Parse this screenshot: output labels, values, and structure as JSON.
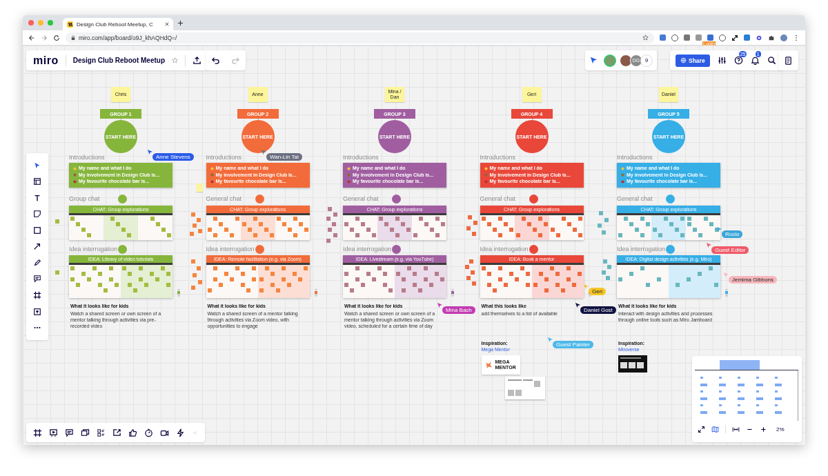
{
  "browser": {
    "tab_title": "Design Club Reboot Meetup, C",
    "url": "miro.com/app/board/o9J_khAQHdQ=/",
    "extension_badge": "Login"
  },
  "board_header": {
    "logo": "miro",
    "title": "Design Club Reboot Meetup",
    "starred": false
  },
  "collaborators": {
    "initials": "DG",
    "count": "9"
  },
  "share_label": "Share",
  "help_badge": "25",
  "notification_badge": "1",
  "groups": [
    {
      "name": "Chris",
      "label": "GROUP 1",
      "color": "#86b53c",
      "start": "START HERE",
      "intro_heading": "Introductions",
      "intro_items": [
        "My name and what I do",
        "My involvement in Design Club is...",
        "My favourite chocolate bar is..."
      ],
      "chat_heading": "Group chat",
      "chat_title": "CHAT: Group explorations",
      "idea_heading": "Idea interrogation",
      "idea_title": "IDEA: Library of video tutorials",
      "looks_heading": "What it looks like for kids",
      "description": "Watch a shared screen or own screen of a mentor talking through activities via pre-recorded video"
    },
    {
      "name": "Anne",
      "label": "GROUP 2",
      "color": "#f26b3a",
      "start": "START HERE",
      "intro_heading": "Introductions",
      "intro_items": [
        "My name and what I do",
        "My involvement in Design Club is...",
        "My favourite chocolate bar is..."
      ],
      "chat_heading": "General chat",
      "chat_title": "CHAT: Group explorations",
      "idea_heading": "Idea interrogation",
      "idea_title": "IDEA: Remote facilitation (e.g. via Zoom)",
      "looks_heading": "What it looks like for kids",
      "description": "Watch a shared screen of a mentor talking through activities via Zoom video, with opportunities to engage"
    },
    {
      "name": "Mina / Dan",
      "label": "GROUP 3",
      "color": "#a05ea0",
      "start": "START HERE",
      "intro_heading": "Introductions",
      "intro_items": [
        "My name and what I do",
        "My involvement in Design Club is...",
        "My favourite chocolate bar is..."
      ],
      "chat_heading": "General chat",
      "chat_title": "CHAT: Group explorations",
      "idea_heading": "Idea interrogation",
      "idea_title": "IDEA: Livestream (e.g. via YouTube)",
      "looks_heading": "What it looks like for kids",
      "description": "Watch a shared screen or own screen of a mentor talking through activities via Zoom video, scheduled for a certain time of day"
    },
    {
      "name": "Geri",
      "label": "GROUP 4",
      "color": "#e8473a",
      "start": "START HERE",
      "intro_heading": "Introductions",
      "intro_items": [
        "My name and what I do",
        "My involvement in Design Club is...",
        "My favourite chocolate bar is..."
      ],
      "chat_heading": "General chat",
      "chat_title": "CHAT: Group explorations",
      "idea_heading": "Idea interrogation",
      "idea_title": "IDEA: Book a mentor",
      "looks_heading": "What this looks like",
      "description": "add themselves to a list of available",
      "inspiration": {
        "label": "Inspiration:",
        "link": "Mega Mentor",
        "thumbnail_text": "MEGA MENTOR"
      }
    },
    {
      "name": "Daniel",
      "label": "GROUP 5",
      "color": "#36aee6",
      "start": "START HERE",
      "intro_heading": "Introductions",
      "intro_items": [
        "My name and what I do",
        "My involvement in Design Club is...",
        "My favourite chocolate bar is..."
      ],
      "chat_heading": "General chat",
      "chat_title": "CHAT: Group explorations",
      "idea_heading": "Idea interrogation",
      "idea_title": "IDEA: Digital design activities (e.g. Miro)",
      "looks_heading": "What it looks like for kids",
      "description": "Interact with design activities and processes through online tools such as Miro Jamboard",
      "inspiration": {
        "label": "Inspiration:",
        "link": "Miroverse"
      }
    }
  ],
  "cursors": [
    {
      "name": "Anne Stevens",
      "color": "#2a5be8"
    },
    {
      "name": "Wan-Lin Tai",
      "color": "#6b6f80"
    },
    {
      "name": "Mina Bach",
      "color": "#c23bb3"
    },
    {
      "name": "Geri",
      "color": "#f5c629"
    },
    {
      "name": "Guest Painter",
      "color": "#4cb8e8"
    },
    {
      "name": "Daniel Gost",
      "color": "#0f1140"
    },
    {
      "name": "Rocio",
      "color": "#3aa5d8"
    },
    {
      "name": "Guest Editor",
      "color": "#ef5a6a"
    },
    {
      "name": "Jemima Gibbons",
      "color": "#f6b7bd"
    }
  ],
  "zoom": "2%"
}
